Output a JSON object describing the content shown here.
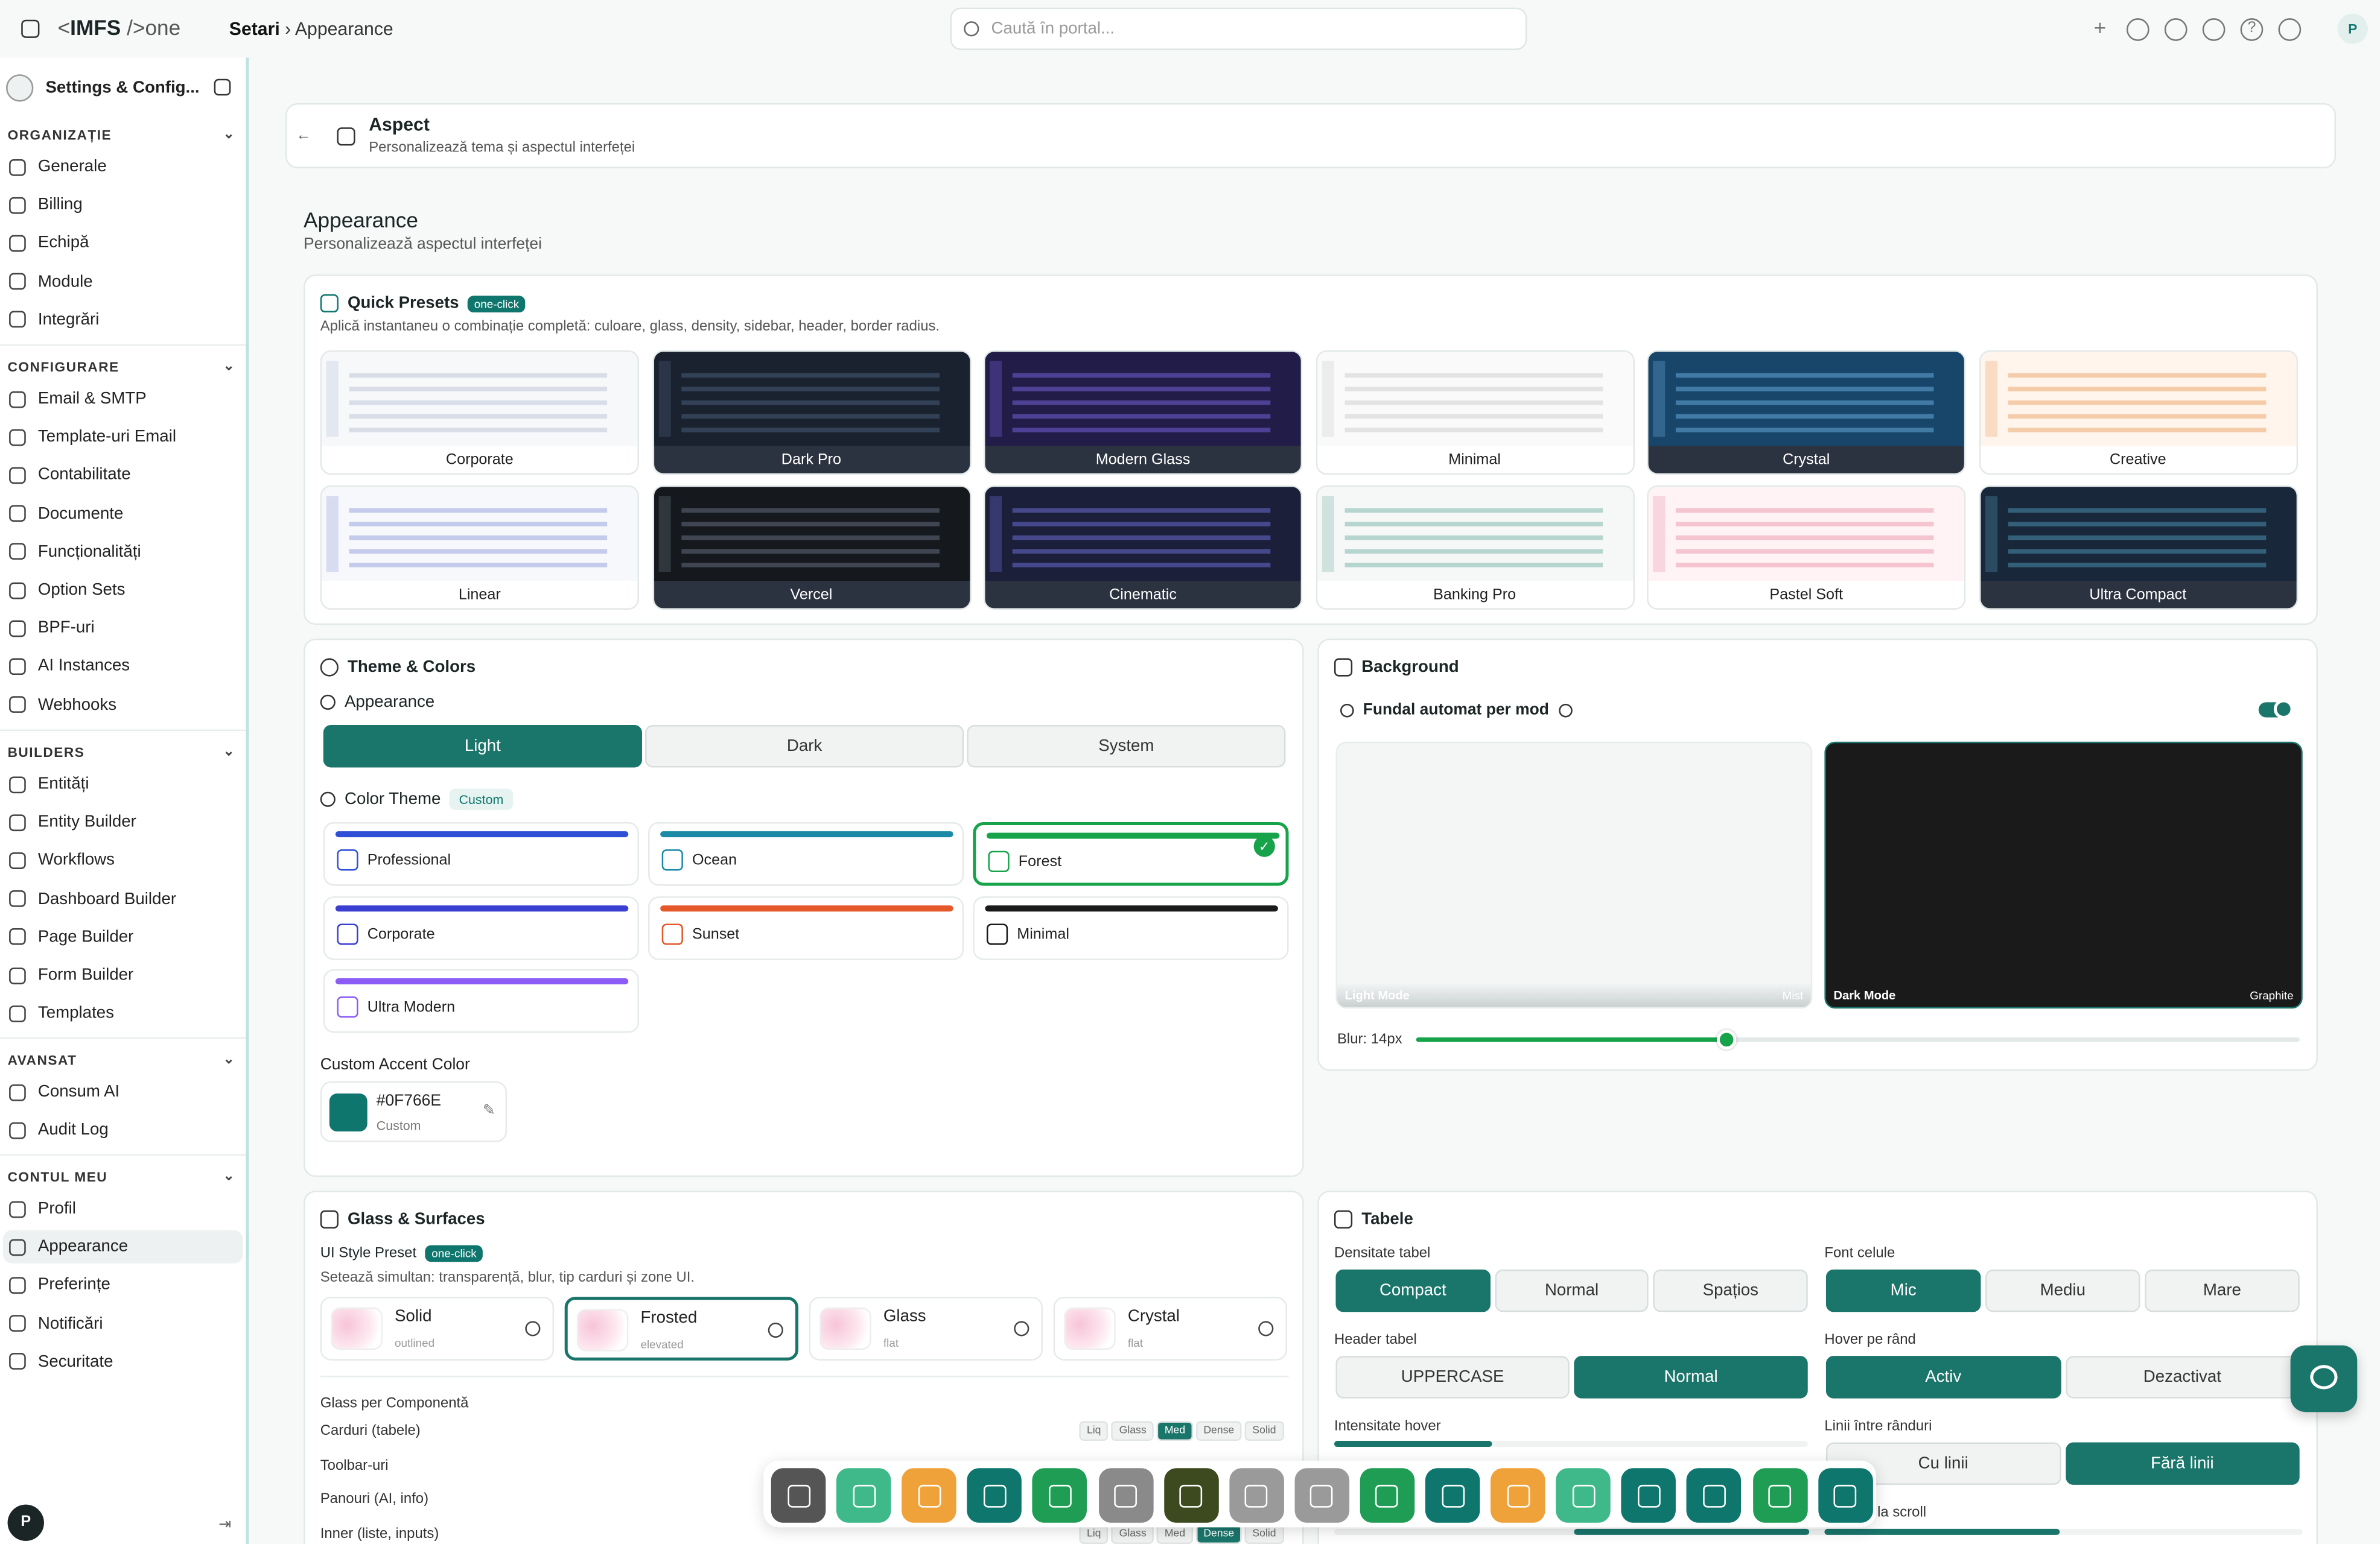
{
  "topbar": {
    "logo_pre": "<",
    "logo_brand": "IMFS",
    "logo_post": " />one",
    "crumb_root": "Setari",
    "crumb_sep": "›",
    "crumb_page": "Appearance",
    "search_placeholder": "Caută în portal...",
    "user_initial": "P"
  },
  "sidebar": {
    "title": "Settings & Config...",
    "sections": [
      {
        "label": "ORGANIZAȚIE",
        "items": [
          "Generale",
          "Billing",
          "Echipă",
          "Module",
          "Integrări"
        ]
      },
      {
        "label": "CONFIGURARE",
        "items": [
          "Email & SMTP",
          "Template-uri Email",
          "Contabilitate",
          "Documente",
          "Funcționalități",
          "Option Sets",
          "BPF-uri",
          "AI Instances",
          "Webhooks"
        ]
      },
      {
        "label": "BUILDERS",
        "items": [
          "Entități",
          "Entity Builder",
          "Workflows",
          "Dashboard Builder",
          "Page Builder",
          "Form Builder",
          "Templates"
        ]
      },
      {
        "label": "AVANSAT",
        "items": [
          "Consum AI",
          "Audit Log"
        ]
      },
      {
        "label": "CONTUL MEU",
        "items": [
          "Profil",
          "Appearance",
          "Preferințe",
          "Notificări",
          "Securitate"
        ]
      }
    ],
    "footer_initial": "P"
  },
  "header_card": {
    "title": "Aspect",
    "subtitle": "Personalizează tema și aspectul interfeței"
  },
  "page": {
    "title": "Appearance",
    "subtitle": "Personalizează aspectul interfeței"
  },
  "presets": {
    "title": "Quick Presets",
    "badge": "one-click",
    "desc": "Aplică instantaneu o combinație completă: culoare, glass, density, sidebar, header, border radius.",
    "row1": [
      "Corporate",
      "Dark Pro",
      "Modern Glass",
      "Minimal",
      "Crystal",
      "Creative"
    ],
    "row2": [
      "Linear",
      "Vercel",
      "Cinematic",
      "Banking Pro",
      "Pastel Soft",
      "Ultra Compact"
    ]
  },
  "theme": {
    "title": "Theme & Colors",
    "appearance_label": "Appearance",
    "modes": [
      "Light",
      "Dark",
      "System"
    ],
    "active_mode": "Light",
    "color_theme_label": "Color Theme",
    "color_theme_badge": "Custom",
    "themes": [
      {
        "name": "Professional",
        "color": "#2f4fd6"
      },
      {
        "name": "Ocean",
        "color": "#1a8aa6"
      },
      {
        "name": "Forest",
        "color": "#16a34a"
      },
      {
        "name": "Corporate",
        "color": "#3b3fd1"
      },
      {
        "name": "Sunset",
        "color": "#e5582a"
      },
      {
        "name": "Minimal",
        "color": "#1a1a1a"
      },
      {
        "name": "Ultra Modern",
        "color": "#8b5cf6"
      }
    ],
    "selected_theme": "Forest",
    "accent_label": "Custom Accent Color",
    "accent_value": "#0F766E",
    "accent_sub": "Custom"
  },
  "background": {
    "title": "Background",
    "auto_label": "Fundal automat per mod",
    "auto_on": true,
    "light_label": "Light Mode",
    "light_sub": "Mist",
    "dark_label": "Dark Mode",
    "dark_sub": "Graphite",
    "blur_label": "Blur: 14px",
    "blur_fraction": 0.35
  },
  "glass": {
    "title": "Glass & Surfaces",
    "preset_label": "UI Style Preset",
    "badge": "one-click",
    "desc": "Setează simultan: transparență, blur, tip carduri și zone UI.",
    "styles": [
      {
        "name": "Solid",
        "sub": "outlined"
      },
      {
        "name": "Frosted",
        "sub": "elevated"
      },
      {
        "name": "Glass",
        "sub": "flat"
      },
      {
        "name": "Crystal",
        "sub": "flat"
      }
    ],
    "selected_style": "Frosted",
    "per_comp_label": "Glass per Componentă",
    "components": [
      "Carduri (tabele)",
      "Toolbar-uri",
      "Panouri (AI, info)",
      "Inner (liste, inputs)"
    ],
    "levels": [
      "Liq",
      "Glass",
      "Med",
      "Dense",
      "Solid"
    ]
  },
  "tables": {
    "title": "Tabele",
    "density_label": "Densitate tabel",
    "density": [
      "Compact",
      "Normal",
      "Spațios"
    ],
    "font_label": "Font celule",
    "font": [
      "Mic",
      "Mediu",
      "Mare"
    ],
    "header_label": "Header tabel",
    "header": [
      "UPPERCASE",
      "Normal"
    ],
    "hover_label": "Hover pe rând",
    "hover": [
      "Activ",
      "Dezactivat"
    ],
    "hover_int_label": "Intensitate hover",
    "lines_label": "Linii între rânduri",
    "lines": [
      "Cu linii",
      "Fără linii"
    ],
    "sticky_label": "r fixat la scroll"
  },
  "colors": {
    "accent": "#0f766e",
    "active_seg": "#1a756b"
  }
}
